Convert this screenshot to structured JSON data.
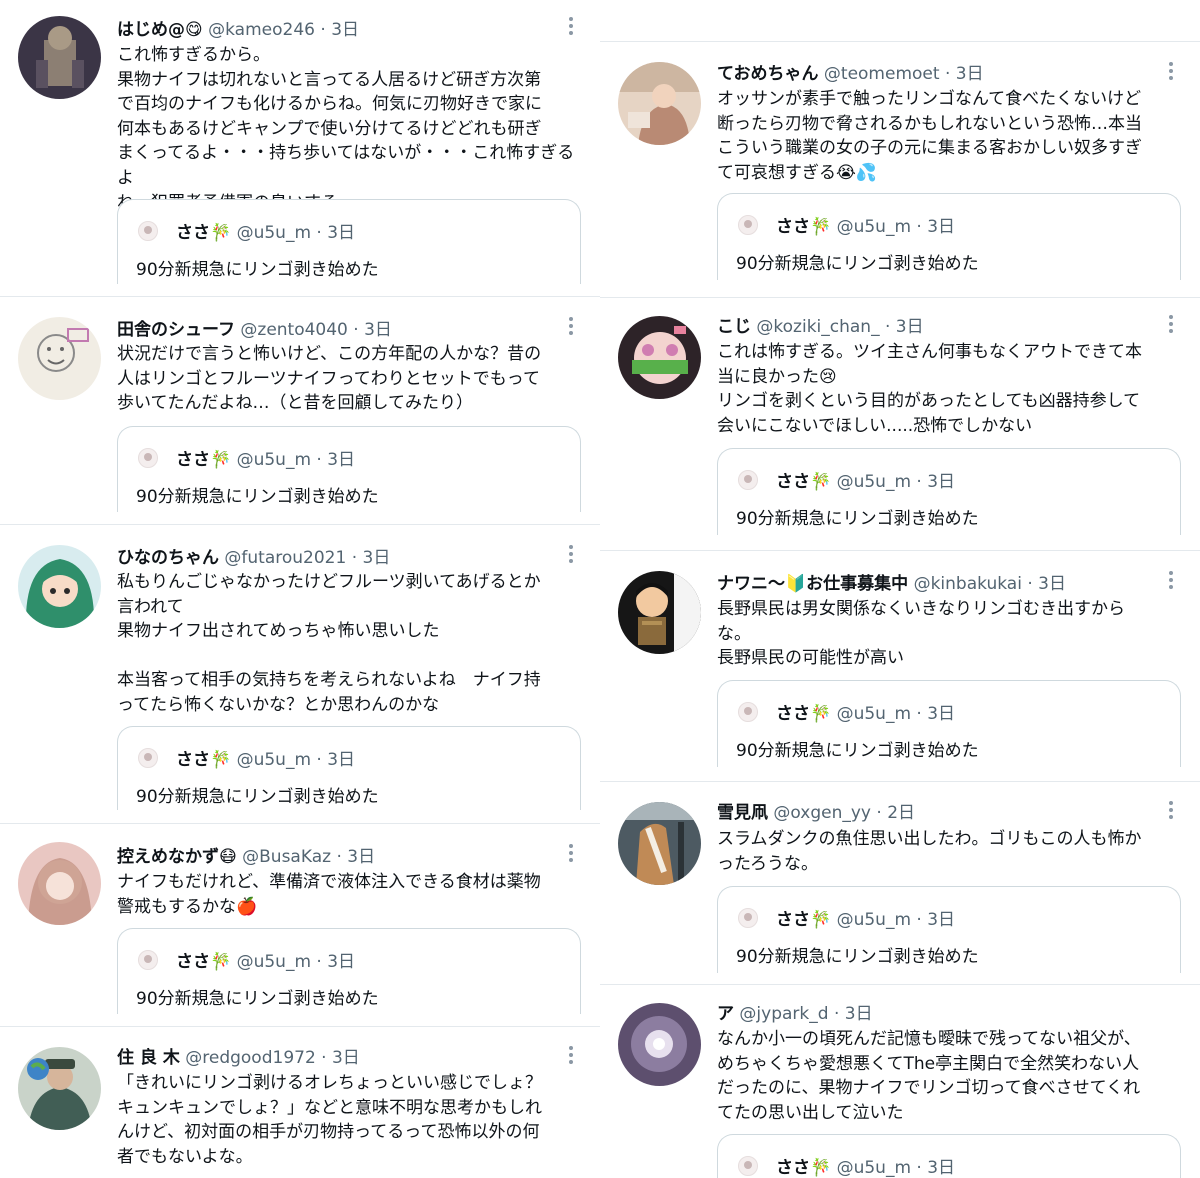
{
  "left_column": [
    {
      "name": "はじめ@😋",
      "handle": "@kameo246",
      "dot": "·",
      "time": "3日",
      "text": "これ怖すぎるから。\n果物ナイフは切れないと言ってる人居るけど研ぎ方次第\nで百均のナイフも化けるからね。何気に刃物好きで家に\n何本もあるけどキャンプで使い分けてるけどどれも研ぎ\nまくってるよ・・・持ち歩いてはないが・・・これ怖すぎるよ\nね。犯罪者予備軍の臭いする。",
      "quote": {
        "name": "ささ🎋",
        "handle": "@u5u_m",
        "dot": "·",
        "time": "3日",
        "text": "90分新規急にリンゴ剥き始めた"
      }
    },
    {
      "name": "田舎のシューフ",
      "handle": "@zento4040",
      "dot": "·",
      "time": "3日",
      "text": "状況だけで言うと怖いけど、この方年配の人かな？昔の\n人はリンゴとフルーツナイフってわりとセットでもって\n歩いてたんだよね…（と昔を回顧してみたり）",
      "quote": {
        "name": "ささ🎋",
        "handle": "@u5u_m",
        "dot": "·",
        "time": "3日",
        "text": "90分新規急にリンゴ剥き始めた"
      }
    },
    {
      "name": "ひなのちゃん",
      "handle": "@futarou2021",
      "dot": "·",
      "time": "3日",
      "text": "私もりんごじゃなかったけどフルーツ剥いてあげるとか\n言われて\n果物ナイフ出されてめっちゃ怖い思いした\n\n本当客って相手の気持ちを考えられないよね　ナイフ持\nってたら怖くないかな？とか思わんのかな",
      "quote": {
        "name": "ささ🎋",
        "handle": "@u5u_m",
        "dot": "·",
        "time": "3日",
        "text": "90分新規急にリンゴ剥き始めた"
      }
    },
    {
      "name": "控えめなかず😷",
      "handle": "@BusaKaz",
      "dot": "·",
      "time": "3日",
      "text": "ナイフもだけれど、準備済で液体注入できる食材は薬物\n警戒もするかな🍎",
      "quote": {
        "name": "ささ🎋",
        "handle": "@u5u_m",
        "dot": "·",
        "time": "3日",
        "text": "90分新規急にリンゴ剥き始めた"
      }
    },
    {
      "name": "住 良 木",
      "handle": "@redgood1972",
      "dot": "·",
      "time": "3日",
      "text": "「きれいにリンゴ剥けるオレちょっといい感じでしょ？\nキュンキュンでしょ？」などと意味不明な思考かもしれ\nんけど、初対面の相手が刃物持ってるって恐怖以外の何\n者でもないよな。",
      "quote": null
    }
  ],
  "right_column": [
    {
      "name": "ておめちゃん",
      "handle": "@teomemoet",
      "dot": "·",
      "time": "3日",
      "text": "オッサンが素手で触ったリンゴなんて食べたくないけど\n断ったら刃物で脅されるかもしれないという恐怖…本当\nこういう職業の女の子の元に集まる客おかしい奴多すぎ\nて可哀想すぎる😭💦",
      "quote": {
        "name": "ささ🎋",
        "handle": "@u5u_m",
        "dot": "·",
        "time": "3日",
        "text": "90分新規急にリンゴ剥き始めた"
      }
    },
    {
      "name": "こじ",
      "handle": "@koziki_chan_",
      "dot": "·",
      "time": "3日",
      "text": "これは怖すぎる。ツイ主さん何事もなくアウトできて本\n当に良かった😢\nリンゴを剥くという目的があったとしても凶器持参して\n会いにこないでほしい.....恐怖でしかない",
      "quote": {
        "name": "ささ🎋",
        "handle": "@u5u_m",
        "dot": "·",
        "time": "3日",
        "text": "90分新規急にリンゴ剥き始めた"
      }
    },
    {
      "name": "ナワニ〜🔰お仕事募集中",
      "handle": "@kinbakukai",
      "dot": "·",
      "time": "3日",
      "text": "長野県民は男女関係なくいきなりリンゴむき出すから\nな。\n長野県民の可能性が高い",
      "quote": {
        "name": "ささ🎋",
        "handle": "@u5u_m",
        "dot": "·",
        "time": "3日",
        "text": "90分新規急にリンゴ剥き始めた"
      }
    },
    {
      "name": "雪見凧",
      "handle": "@oxgen_yy",
      "dot": "·",
      "time": "2日",
      "text": "スラムダンクの魚住思い出したわ。ゴリもこの人も怖か\nったろうな。",
      "quote": {
        "name": "ささ🎋",
        "handle": "@u5u_m",
        "dot": "·",
        "time": "3日",
        "text": "90分新規急にリンゴ剥き始めた"
      }
    },
    {
      "name": "ア",
      "handle": "@jypark_d",
      "dot": "·",
      "time": "3日",
      "text": "なんか小一の頃死んだ記憶も曖昧で残ってない祖父が、\nめちゃくちゃ愛想悪くてThe亭主関白で全然笑わない人\nだったのに、果物ナイフでリンゴ切って食べさせてくれ\nてたの思い出して泣いた",
      "quote": {
        "name": "ささ🎋",
        "handle": "@u5u_m",
        "dot": "·",
        "time": "3日",
        "text": ""
      }
    }
  ]
}
